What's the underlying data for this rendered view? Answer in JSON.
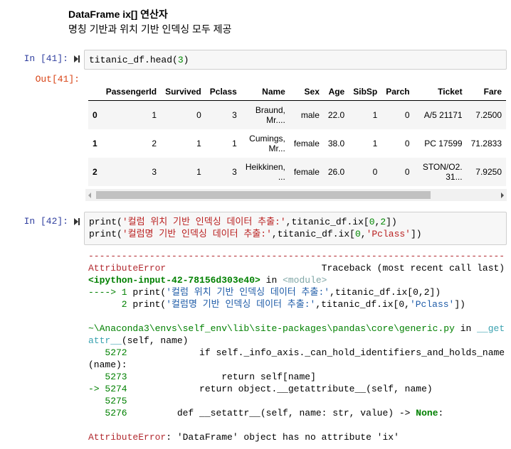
{
  "markdown": {
    "title": "DataFrame ix[] 연산자",
    "subtitle": "명칭 기반과 위치 기반 인덱싱 모두 제공"
  },
  "cell41": {
    "prompt_in": "In [41]:",
    "prompt_out": "Out[41]:",
    "code": [
      [
        "titanic_df.head(",
        "plain"
      ],
      [
        "3",
        "num"
      ],
      [
        ")",
        "plain"
      ]
    ]
  },
  "table": {
    "columns": [
      "",
      "PassengerId",
      "Survived",
      "Pclass",
      "Name",
      "Sex",
      "Age",
      "SibSp",
      "Parch",
      "Ticket",
      "Fare"
    ],
    "rows": [
      [
        "0",
        "1",
        "0",
        "3",
        "Braund, Mr....",
        "male",
        "22.0",
        "1",
        "0",
        "A/5 21171",
        "7.2500"
      ],
      [
        "1",
        "2",
        "1",
        "1",
        "Cumings, Mr...",
        "female",
        "38.0",
        "1",
        "0",
        "PC 17599",
        "71.2833"
      ],
      [
        "2",
        "3",
        "1",
        "3",
        "Heikkinen, ...",
        "female",
        "26.0",
        "0",
        "0",
        "STON/O2. 31...",
        "7.9250"
      ]
    ]
  },
  "cell42": {
    "prompt_in": "In [42]:",
    "code": [
      [
        [
          "print(",
          "plain"
        ],
        [
          "'컬럼 위치 기반 인덱싱 데이터 추출:'",
          "str"
        ],
        [
          ",titanic_df.ix[",
          "plain"
        ],
        [
          "0",
          "num"
        ],
        [
          ",",
          "plain"
        ],
        [
          "2",
          "num"
        ],
        [
          "])",
          "plain"
        ]
      ],
      [
        [
          "print(",
          "plain"
        ],
        [
          "'컬럼명 기반 인덱싱 데이터 추출:'",
          "str"
        ],
        [
          ",titanic_df.ix[",
          "plain"
        ],
        [
          "0",
          "num"
        ],
        [
          ",",
          "plain"
        ],
        [
          "'Pclass'",
          "str"
        ],
        [
          "])",
          "plain"
        ]
      ]
    ]
  },
  "traceback": [
    [
      [
        "---------------------------------------------------------------------------",
        "red"
      ]
    ],
    [
      [
        "AttributeError",
        "red"
      ],
      [
        "                            Traceback (most recent call last)",
        "plain"
      ]
    ],
    [
      [
        "<ipython-input-42-78156d303e40>",
        "bold-green"
      ],
      [
        " in ",
        "plain"
      ],
      [
        "<module>",
        "gray"
      ]
    ],
    [
      [
        "----> 1 ",
        "green"
      ],
      [
        "print(",
        "plain"
      ],
      [
        "'컬럼 위치 기반 인덱싱 데이터 추출:'",
        "blue"
      ],
      [
        ",titanic_df.ix[0,2])",
        "plain"
      ]
    ],
    [
      [
        "      2 ",
        "green"
      ],
      [
        "print(",
        "plain"
      ],
      [
        "'컬럼명 기반 인덱싱 데이터 추출:'",
        "blue"
      ],
      [
        ",titanic_df.ix[0,",
        "plain"
      ],
      [
        "'Pclass'",
        "blue"
      ],
      [
        "])",
        "plain"
      ]
    ],
    [
      [
        "",
        "plain"
      ]
    ],
    [
      [
        "~\\Anaconda3\\envs\\self_env\\lib\\site-packages\\pandas\\core\\generic.py",
        "green"
      ],
      [
        " in ",
        "plain"
      ],
      [
        "__get",
        "cyan"
      ]
    ],
    [
      [
        "attr__",
        "cyan"
      ],
      [
        "(self, name)",
        "plain"
      ]
    ],
    [
      [
        "   5272 ",
        "green"
      ],
      [
        "            if self._info_axis._can_hold_identifiers_and_holds_name",
        "plain"
      ]
    ],
    [
      [
        "(name):",
        "plain"
      ]
    ],
    [
      [
        "   5273 ",
        "green"
      ],
      [
        "                return self[name]",
        "plain"
      ]
    ],
    [
      [
        "-> 5274 ",
        "green"
      ],
      [
        "            return object.__getattribute__(self, name)",
        "plain"
      ]
    ],
    [
      [
        "   5275 ",
        "green"
      ]
    ],
    [
      [
        "   5276 ",
        "green"
      ],
      [
        "        def __setattr__(self, name: str, value) -> ",
        "plain"
      ],
      [
        "None",
        "bold-green"
      ],
      [
        ":",
        "plain"
      ]
    ],
    [
      [
        "",
        "plain"
      ]
    ],
    [
      [
        "AttributeError",
        "red"
      ],
      [
        ": 'DataFrame' object has no attribute 'ix'",
        "plain"
      ]
    ]
  ]
}
